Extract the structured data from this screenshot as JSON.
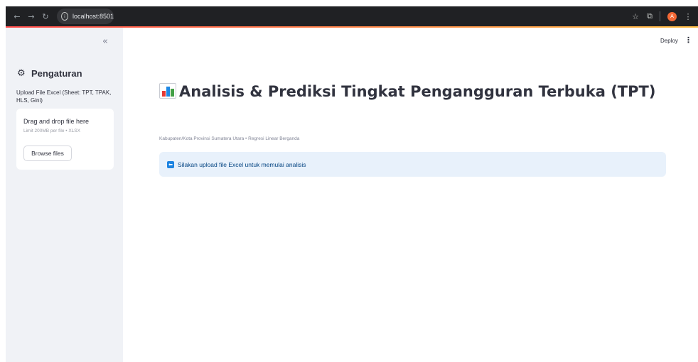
{
  "browser": {
    "url": "localhost:8501",
    "profile_initial": "A",
    "accent_colors": [
      "#ff4b4b",
      "#ffbd45"
    ]
  },
  "sidebar": {
    "collapse_glyph": "«",
    "title": "Pengaturan",
    "upload_label": "Upload File Excel (Sheet: TPT, TPAK, HLS, Gini)",
    "dropzone": {
      "title": "Drag and drop file here",
      "limit": "Limit 200MB per file • XLSX",
      "browse_label": "Browse files"
    }
  },
  "header": {
    "deploy_label": "Deploy"
  },
  "main": {
    "title": "Analisis & Prediksi Tingkat Pengangguran Terbuka (TPT)",
    "subtitle": "Kabupaten/Kota Provinsi Sumatera Utara • Regresi Linear Berganda",
    "info_message": "Silakan upload file Excel untuk memulai analisis",
    "info_color": "#1c83e1"
  }
}
